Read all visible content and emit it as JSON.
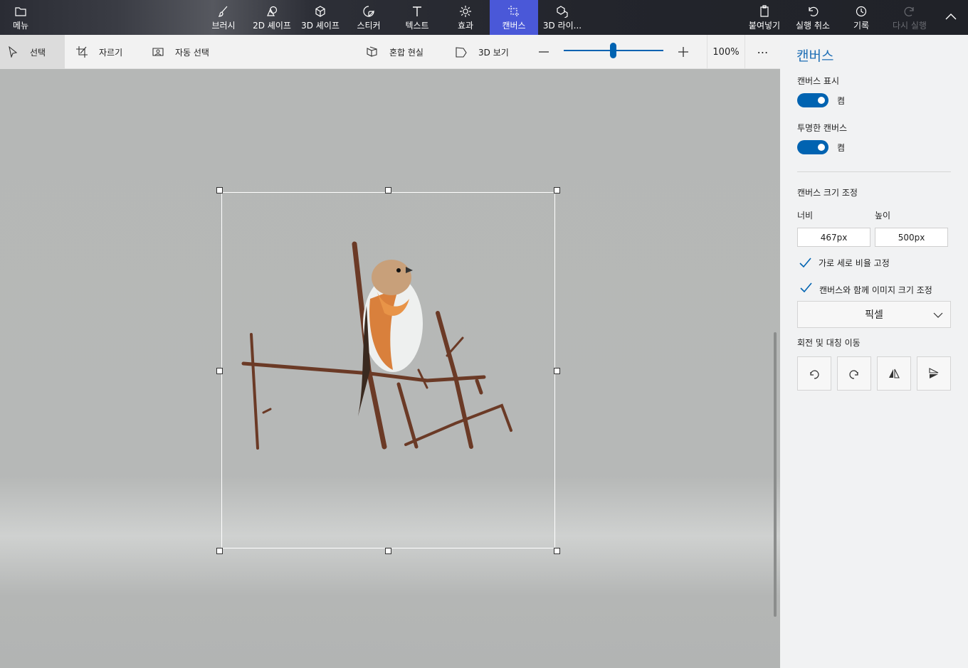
{
  "topbar": {
    "menu_label": "메뉴",
    "tabs": [
      {
        "label": "브러시",
        "icon": "brush-icon"
      },
      {
        "label": "2D 셰이프",
        "icon": "2d-shapes-icon"
      },
      {
        "label": "3D 셰이프",
        "icon": "3d-shapes-icon"
      },
      {
        "label": "스티커",
        "icon": "sticker-icon"
      },
      {
        "label": "텍스트",
        "icon": "text-icon"
      },
      {
        "label": "효과",
        "icon": "effects-icon"
      },
      {
        "label": "캔버스",
        "icon": "canvas-icon",
        "active": true
      },
      {
        "label": "3D 라이...",
        "icon": "3d-library-icon"
      }
    ],
    "paste_label": "붙여넣기",
    "undo_label": "실행 취소",
    "history_label": "기록",
    "redo_label": "다시 실행"
  },
  "toolbar": {
    "select_label": "선택",
    "crop_label": "자르기",
    "magic_select_label": "자동 선택",
    "mixed_reality_label": "혼합 현실",
    "view3d_label": "3D 보기",
    "zoom_value": "100%",
    "zoom_level": 0.5,
    "more_label": "⋯"
  },
  "panel": {
    "title": "캔버스",
    "show_canvas_label": "캔버스 표시",
    "show_canvas_state": "켬",
    "transparent_label": "투명한 캔버스",
    "transparent_state": "켬",
    "resize_label": "캔버스 크기 조정",
    "width_label": "너비",
    "height_label": "높이",
    "width_value": "467px",
    "height_value": "500px",
    "lock_aspect_label": "가로 세로 비율 고정",
    "resize_image_label": "캔버스와 함께 이미지 크기 조정",
    "unit_value": "픽셀",
    "rotate_label": "회전 및 대칭 이동"
  },
  "colors": {
    "accent": "#0063b1",
    "active_tab": "#4a58d8",
    "title_blue": "#1f6fb5",
    "canvas_bg": "#b4b6b5"
  }
}
